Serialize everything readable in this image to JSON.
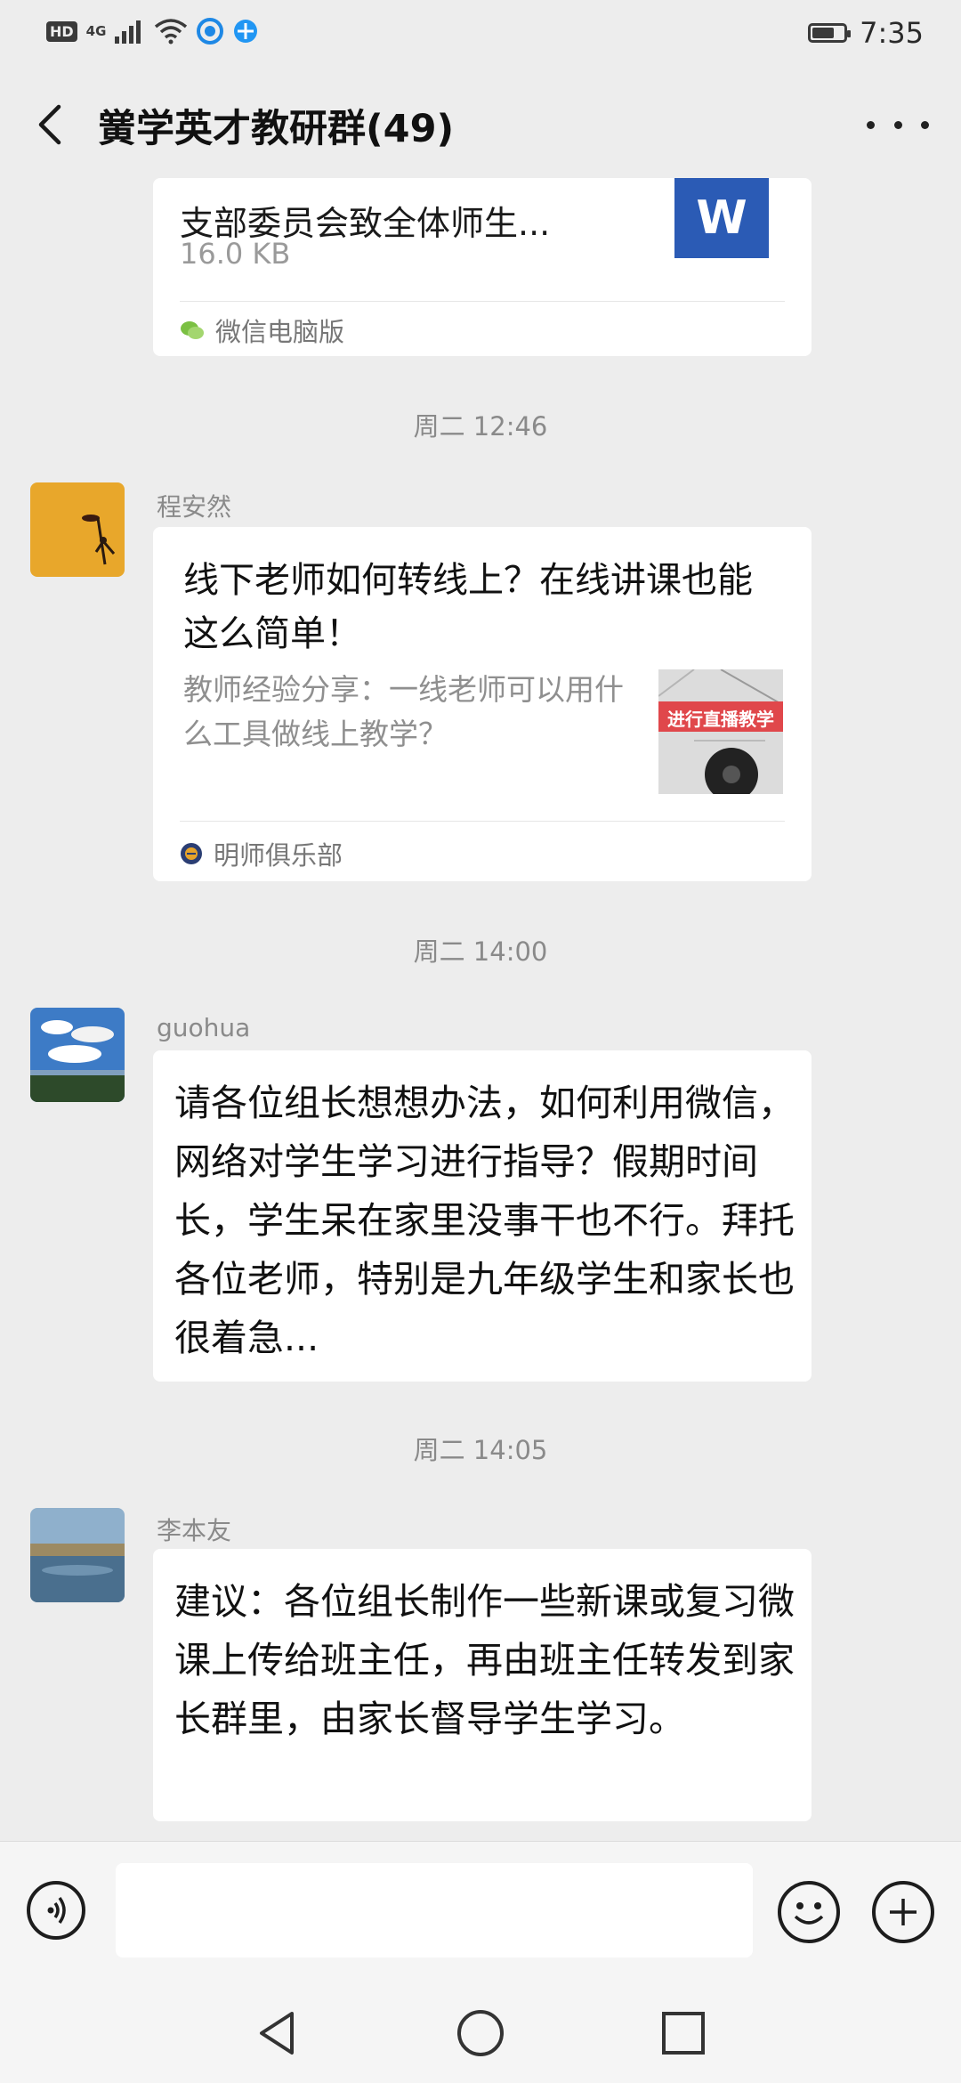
{
  "status_bar": {
    "hd": "HD",
    "network": "4G",
    "time": "7:35",
    "battery_level": 0.7
  },
  "header": {
    "title": "黉学英才教研群(49)"
  },
  "file_card": {
    "file_name": "支部委员会致全体师生...",
    "file_size": "16.0 KB",
    "file_icon_letter": "W",
    "source": "微信电脑版"
  },
  "timestamps": [
    "周二 12:46",
    "周二 14:00",
    "周二 14:05"
  ],
  "link_message": {
    "sender": "程安然",
    "title": "线下老师如何转线上？在线讲课也能这么简单！",
    "description": "教师经验分享：一线老师可以用什么工具做线上教学？",
    "thumbnail_text": "进行直播教学",
    "source": "明师俱乐部"
  },
  "message_guohua": {
    "sender": "guohua",
    "text": "请各位组长想想办法，如何利用微信，网络对学生学习进行指导？假期时间长，学生呆在家里没事干也不行。拜托各位老师，特别是九年级学生和家长也很着急..."
  },
  "message_li": {
    "sender": "李本友",
    "text": "建议：各位组长制作一些新课或复习微课上传给班主任，再由班主任转发到家长群里，由家长督导学生学习。"
  },
  "input_bar": {
    "placeholder": ""
  },
  "colors": {
    "background": "#ededed",
    "bubble": "#ffffff",
    "word_blue": "#2b5bb5",
    "thumb_red": "#e0474b"
  }
}
